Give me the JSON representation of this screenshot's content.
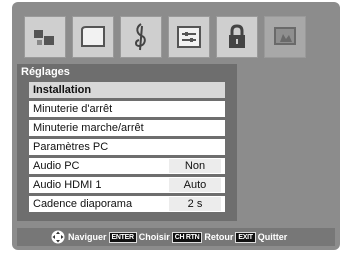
{
  "menu_title": "Réglages",
  "icons": [
    {
      "name": "picture-icon"
    },
    {
      "name": "screen-size-icon"
    },
    {
      "name": "audio-icon"
    },
    {
      "name": "settings-icon"
    },
    {
      "name": "lock-icon"
    },
    {
      "name": "installation-icon"
    }
  ],
  "items": [
    {
      "label": "Installation"
    },
    {
      "label": "Minuterie d'arrêt"
    },
    {
      "label": "Minuterie marche/arrêt"
    },
    {
      "label": "Paramètres PC"
    },
    {
      "label": "Audio PC",
      "value": "Non"
    },
    {
      "label": "Audio HDMI 1",
      "value": "Auto"
    },
    {
      "label": "Cadence diaporama",
      "value": "2 s"
    }
  ],
  "footer": {
    "navigate": "Naviguer",
    "enter_key": "ENTER",
    "choose": "Choisir",
    "ch_rtn_key": "CH RTN",
    "back": "Retour",
    "exit_key": "EXIT",
    "quit": "Quitter"
  },
  "colors": {
    "frame": "#8c8c8c",
    "panel": "#6e6e6e",
    "row": "#ffffff",
    "header_row": "#d8d8d8"
  }
}
